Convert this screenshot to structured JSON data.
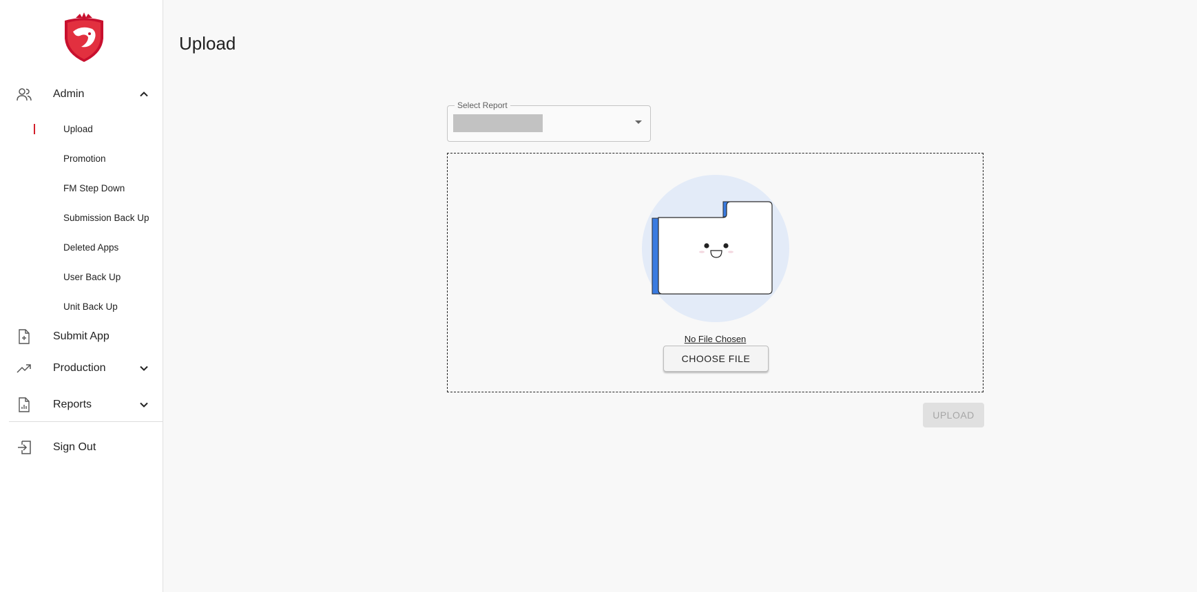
{
  "app": {
    "colors": {
      "accent": "#d21f2b",
      "folder_blue": "#3a7be0",
      "illustration_bg": "#e3ebf8"
    }
  },
  "sidebar": {
    "logo_icon": "eagle-shield-logo",
    "admin": {
      "label": "Admin",
      "icon": "users-icon",
      "expanded": true
    },
    "admin_items": [
      {
        "label": "Upload",
        "active": true
      },
      {
        "label": "Promotion"
      },
      {
        "label": "FM Step Down"
      },
      {
        "label": "Submission Back Up"
      },
      {
        "label": "Deleted Apps"
      },
      {
        "label": "User Back Up"
      },
      {
        "label": "Unit Back Up"
      }
    ],
    "submit_app": {
      "label": "Submit App",
      "icon": "file-plus-icon"
    },
    "production": {
      "label": "Production",
      "icon": "trending-up-icon",
      "expanded": false
    },
    "reports": {
      "label": "Reports",
      "icon": "report-chart-icon",
      "expanded": false
    },
    "sign_out": {
      "label": "Sign Out",
      "icon": "sign-out-icon"
    }
  },
  "main": {
    "title": "Upload",
    "select": {
      "label": "Select Report",
      "value": ""
    },
    "dropzone": {
      "status": "No File Chosen",
      "choose_label": "CHOOSE FILE"
    },
    "upload_label": "UPLOAD"
  }
}
